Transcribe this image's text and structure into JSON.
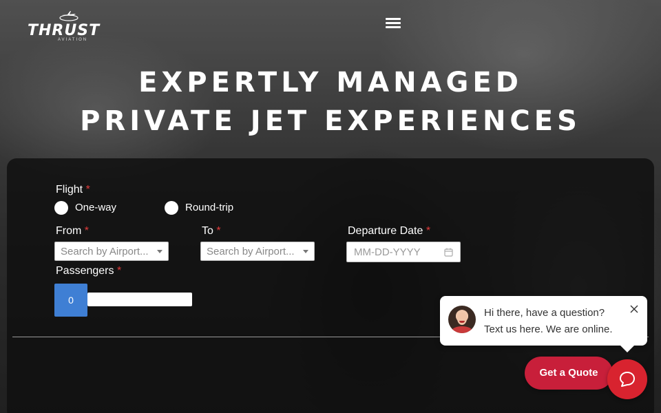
{
  "brand": {
    "name": "THRUST",
    "sub": "AVIATION"
  },
  "hero": {
    "line1": "EXPERTLY MANAGED",
    "line2": "PRIVATE JET EXPERIENCES"
  },
  "form": {
    "flight_label": "Flight",
    "required_mark": "*",
    "trip_options": [
      "One-way",
      "Round-trip"
    ],
    "from_label": "From",
    "from_placeholder": "Search by Airport...",
    "to_label": "To",
    "to_placeholder": "Search by Airport...",
    "date_label": "Departure Date",
    "date_placeholder": "MM-DD-YYYY",
    "passengers_label": "Passengers",
    "passengers_value": "0"
  },
  "chat": {
    "line1": "Hi there, have a question?",
    "line2": "Text us here. We are online."
  },
  "cta": {
    "quote_label": "Get a Quote"
  },
  "colors": {
    "accent_red": "#c81f3a",
    "required_red": "#e03b3b",
    "stepper_blue": "#3f7fd4"
  },
  "icons": [
    "menu-icon",
    "calendar-icon",
    "close-icon",
    "chat-icon",
    "plane-icon"
  ]
}
